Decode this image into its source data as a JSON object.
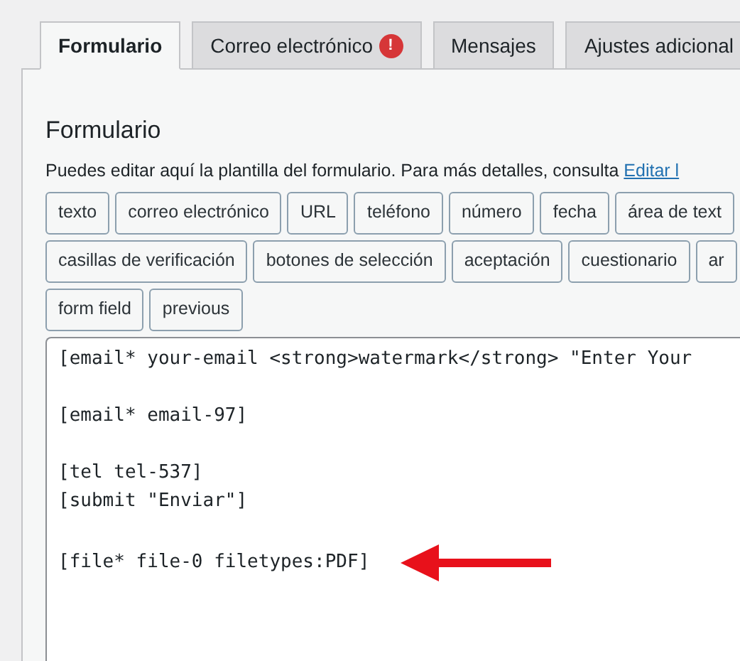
{
  "tabs": [
    {
      "label": "Formulario",
      "selected": true
    },
    {
      "label": "Correo electrónico",
      "selected": false,
      "alert": "!"
    },
    {
      "label": "Mensajes",
      "selected": false
    },
    {
      "label": "Ajustes adicional",
      "selected": false
    }
  ],
  "panel": {
    "title": "Formulario",
    "description": "Puedes editar aquí la plantilla del formulario. Para más detalles, consulta ",
    "link": "Editar l"
  },
  "tag_buttons": [
    [
      "texto",
      "correo electrónico",
      "URL",
      "teléfono",
      "número",
      "fecha",
      "área de text"
    ],
    [
      "casillas de verificación",
      "botones de selección",
      "aceptación",
      "cuestionario",
      "ar"
    ],
    [
      "form field",
      "previous"
    ]
  ],
  "editor": {
    "blocks": [
      [
        "[email* your-email <strong>watermark</strong> \"Enter Your"
      ],
      [
        "[email* email-97]"
      ],
      [
        "[tel tel-537]",
        "[submit \"Enviar\"]"
      ],
      [
        "[file* file-0 filetypes:PDF]"
      ]
    ]
  }
}
